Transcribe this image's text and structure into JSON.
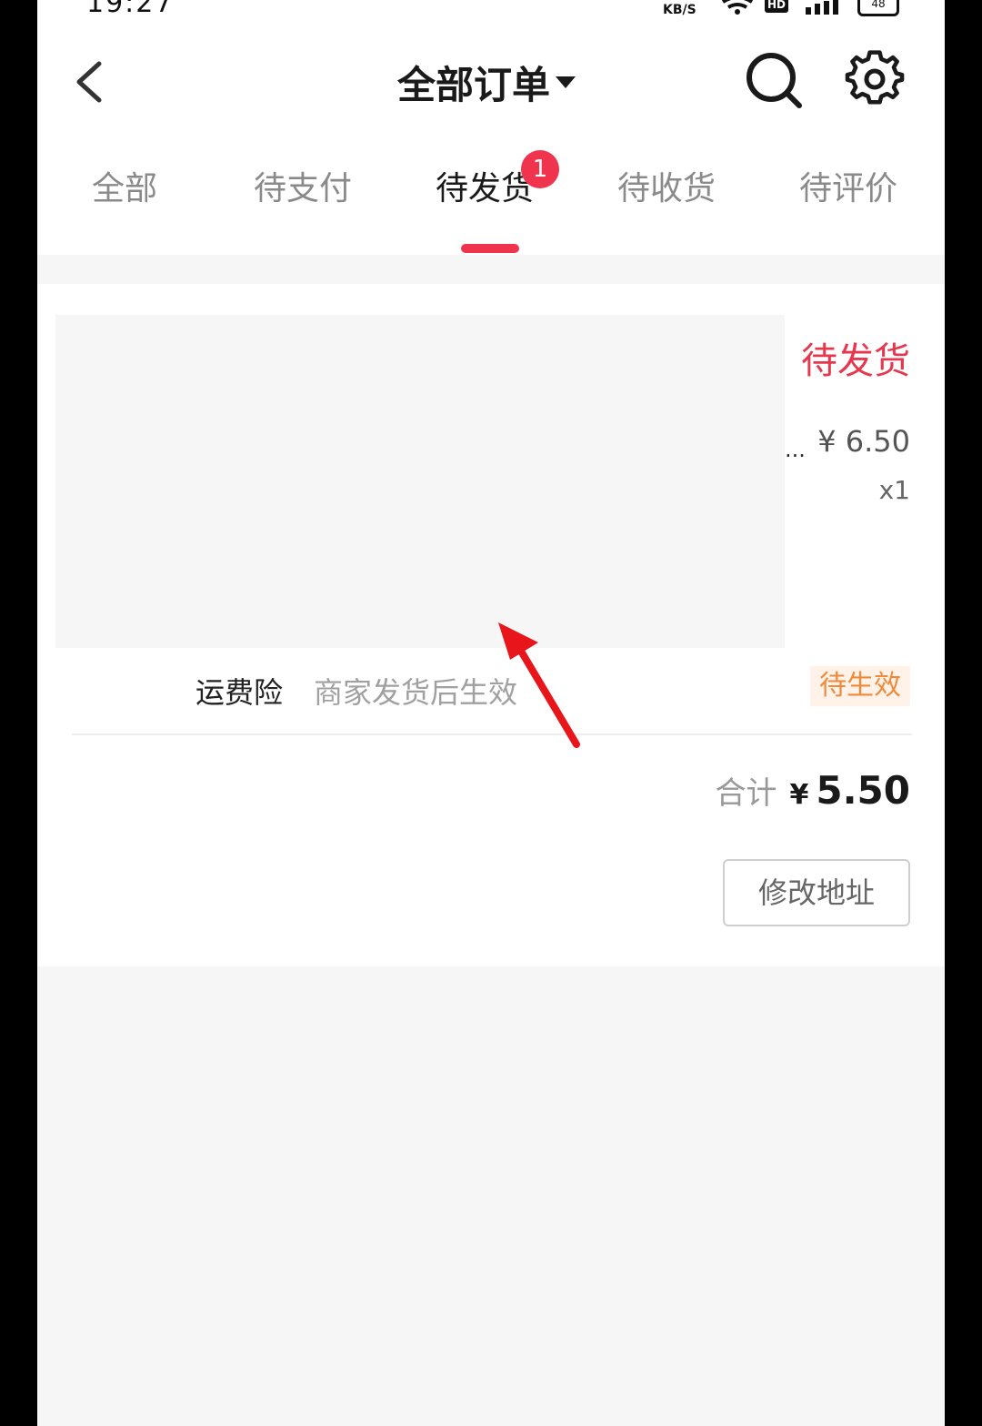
{
  "status_bar": {
    "time": "19:27",
    "network_speed_unit": "KB/S",
    "hd_label": "HD",
    "battery": "48"
  },
  "nav": {
    "title": "全部订单",
    "back_icon": "chevron-left-icon",
    "search_icon": "search-icon",
    "settings_icon": "gear-icon"
  },
  "tabs": [
    {
      "label": "全部",
      "active": false
    },
    {
      "label": "待支付",
      "active": false
    },
    {
      "label": "待发货",
      "active": true,
      "badge": "1"
    },
    {
      "label": "待收货",
      "active": false
    },
    {
      "label": "待评价",
      "active": false
    }
  ],
  "order": {
    "status": "待发货",
    "title_ellipsis": "...",
    "price": "¥ 6.50",
    "quantity": "x1",
    "insurance": {
      "label": "运费险",
      "description": "商家发货后生效",
      "badge": "待生效"
    },
    "total": {
      "label": "合计",
      "currency": "¥",
      "value": "5.50"
    },
    "modify_address_label": "修改地址"
  },
  "colors": {
    "accent": "#f0344d",
    "status_text": "#e6374f",
    "insurance_badge_bg": "#fff2e8",
    "insurance_badge_text": "#f08a3b",
    "annotation_arrow": "#e8151b"
  }
}
